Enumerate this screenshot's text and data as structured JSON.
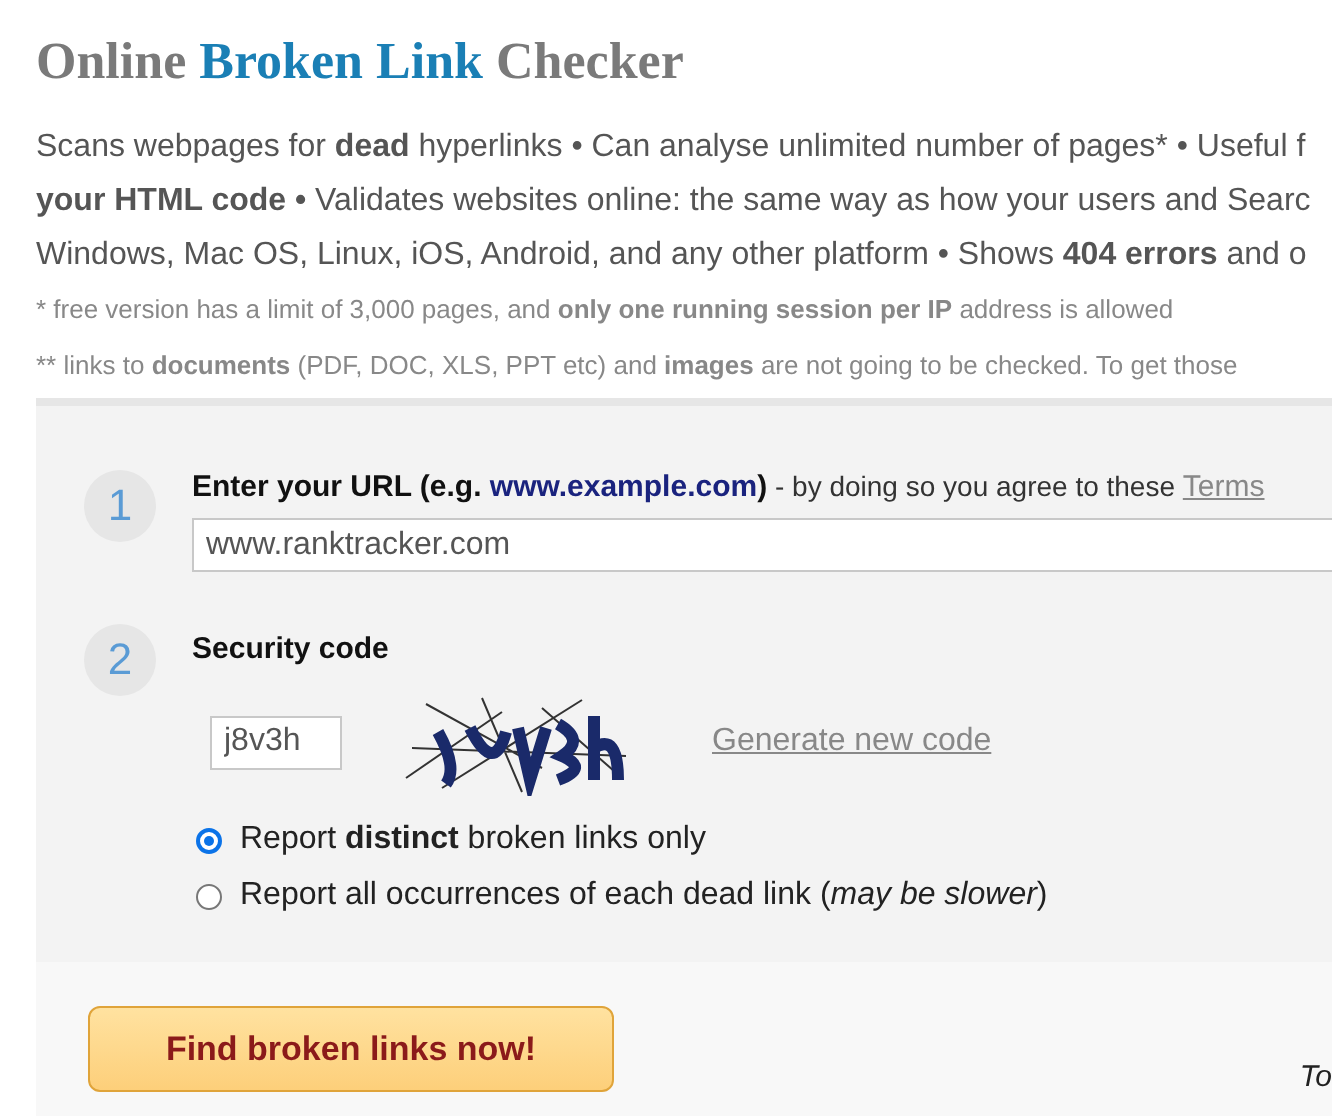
{
  "title": [
    {
      "text": "Online ",
      "highlight": false
    },
    {
      "text": "Broken Link",
      "highlight": true
    },
    {
      "text": " Checker",
      "highlight": false
    }
  ],
  "description": [
    "Scans webpages for **dead** hyperlinks • Can analyse unlimited number of pages* • Useful f",
    "**your HTML code •** Validates websites online: the same way as how your users and Searc",
    "Windows, Mac OS, Linux, iOS, Android, and any other platform • Shows **404 errors** and o"
  ],
  "footnotes": [
    "*  free version has a limit of 3,000 pages, and **only one running session per IP** address is allowed",
    "** links to **documents** (PDF, DOC, XLS, PPT etc) and **images** are not going to be checked. To get those"
  ],
  "steps": [
    {
      "number": "1",
      "kind": "url",
      "label": "Enter your URL (e.g. ",
      "example": "www.example.com",
      "label_end": ")",
      "note": " - by doing so you agree to these ",
      "link": "Terms",
      "value": "www.ranktracker.com"
    },
    {
      "number": "2",
      "kind": "captcha",
      "label": "Security code",
      "value": "j8v3h",
      "link": "Generate new code"
    }
  ],
  "options": [
    {
      "label": "Report **distinct** broken links only",
      "selected": true
    },
    {
      "label": "Report all occurrences of each dead link (*may be slower*)",
      "selected": false
    }
  ],
  "submit": "Find broken links now!",
  "side_text": "To"
}
